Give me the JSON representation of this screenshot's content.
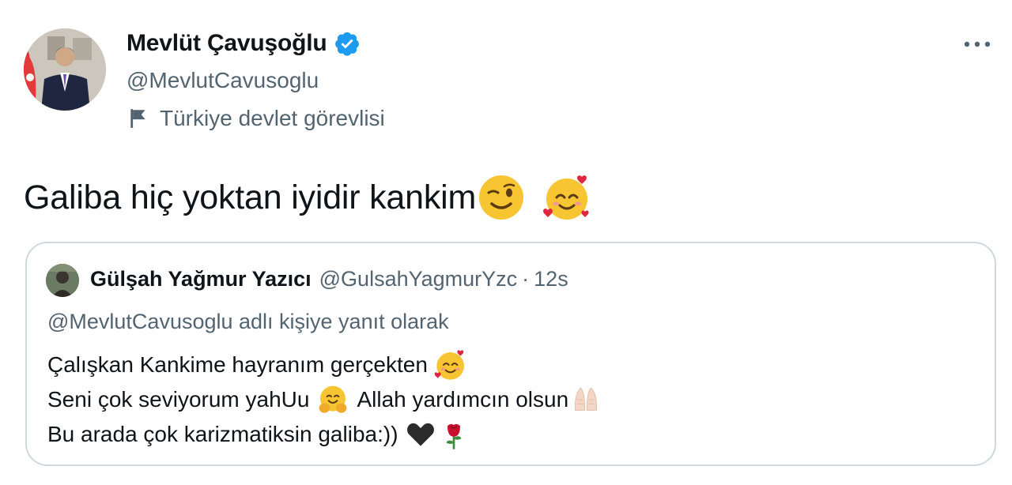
{
  "author": {
    "display_name": "Mevlüt Çavuşoğlu",
    "handle": "@MevlutCavusoglu",
    "affiliation": "Türkiye devlet görevlisi"
  },
  "tweet": {
    "text": "Galiba hiç yoktan iyidir kankim",
    "emojis": [
      "winking-face-emoji",
      "smiling-face-with-hearts-emoji"
    ]
  },
  "quoted_tweet": {
    "author_name": "Gülşah Yağmur Yazıcı",
    "author_handle": "@GulsahYagmurYzc",
    "separator": "·",
    "time": "12s",
    "reply_context": "@MevlutCavusoglu adlı kişiye yanıt olarak",
    "lines": [
      {
        "text": "Çalışkan Kankime hayranım gerçekten",
        "emoji": "smiling-face-with-hearts-emoji"
      },
      {
        "text_a": "Seni çok seviyorum yahUu",
        "emoji_a": "hugging-face-emoji",
        "text_b": "Allah yardımcın olsun",
        "emoji_b": "folded-hands-emoji"
      },
      {
        "text": "Bu arada çok karizmatiksin galiba:))",
        "emojis": [
          "black-heart-emoji",
          "rose-emoji"
        ]
      }
    ]
  },
  "icons": {
    "verified": "verified-badge-icon",
    "affiliation": "flag-icon",
    "more": "more-horizontal-icon"
  },
  "colors": {
    "text_primary": "#0f1419",
    "text_secondary": "#536471",
    "verified_blue": "#1d9bf0",
    "border": "#cfd9de"
  }
}
